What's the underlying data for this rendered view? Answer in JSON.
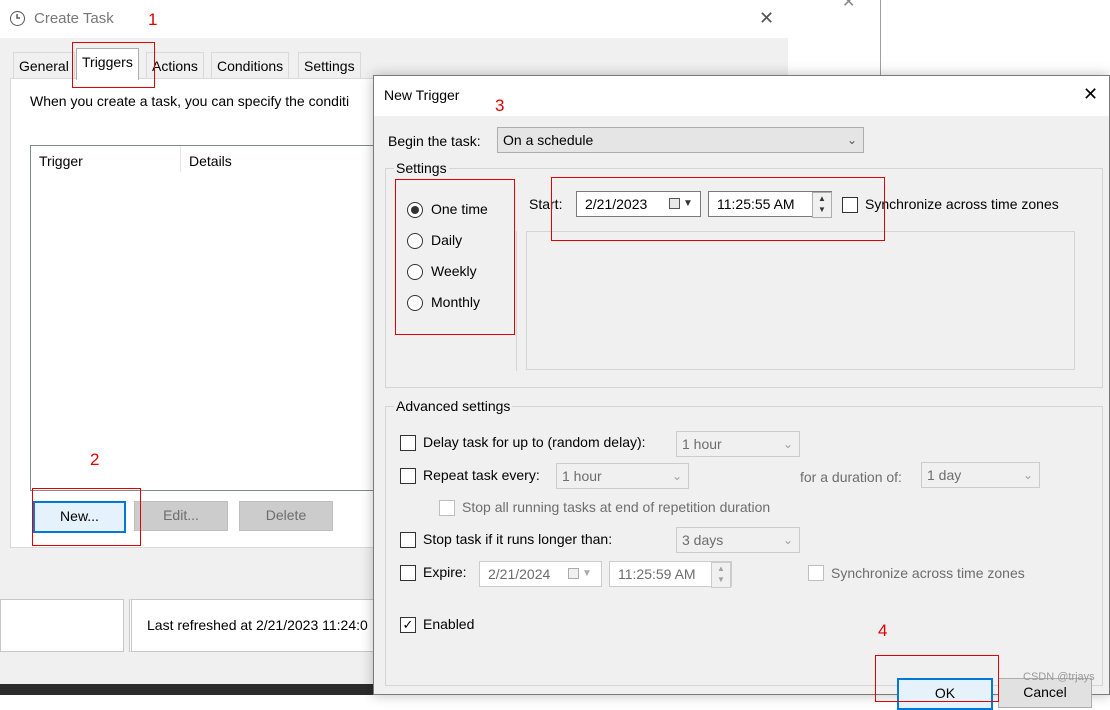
{
  "create_task": {
    "title": "Create Task",
    "tabs": [
      "General",
      "Triggers",
      "Actions",
      "Conditions",
      "Settings"
    ],
    "description": "When you create a task, you can specify the conditi",
    "table_headers": [
      "Trigger",
      "Details"
    ],
    "buttons": {
      "new": "New...",
      "edit": "Edit...",
      "delete": "Delete"
    },
    "status_text": "Last refreshed at 2/21/2023 11:24:0"
  },
  "new_trigger": {
    "title": "New Trigger",
    "begin_label": "Begin the task:",
    "begin_value": "On a schedule",
    "settings_label": "Settings",
    "schedule_options": [
      {
        "label": "One time",
        "checked": true
      },
      {
        "label": "Daily",
        "checked": false
      },
      {
        "label": "Weekly",
        "checked": false
      },
      {
        "label": "Monthly",
        "checked": false
      }
    ],
    "start_label": "Start:",
    "start_date": "2/21/2023",
    "start_time": "11:25:55 AM",
    "sync_label": "Synchronize across time zones",
    "advanced_label": "Advanced settings",
    "delay_label": "Delay task for up to (random delay):",
    "delay_value": "1 hour",
    "repeat_label": "Repeat task every:",
    "repeat_value": "1 hour",
    "duration_label": "for a duration of:",
    "duration_value": "1 day",
    "stop_running_label": "Stop all running tasks at end of repetition duration",
    "stop_longer_label": "Stop task if it runs longer than:",
    "stop_longer_value": "3 days",
    "expire_label": "Expire:",
    "expire_date": "2/21/2024",
    "expire_time": "11:25:59 AM",
    "expire_sync_label": "Synchronize across time zones",
    "enabled_label": "Enabled",
    "enabled_checked": true,
    "ok_label": "OK",
    "cancel_label": "Cancel"
  },
  "annotations": [
    "1",
    "2",
    "3",
    "4"
  ],
  "watermark": "CSDN @trjays",
  "colors": {
    "annotation": "#e00000",
    "focus": "#0078d7"
  }
}
